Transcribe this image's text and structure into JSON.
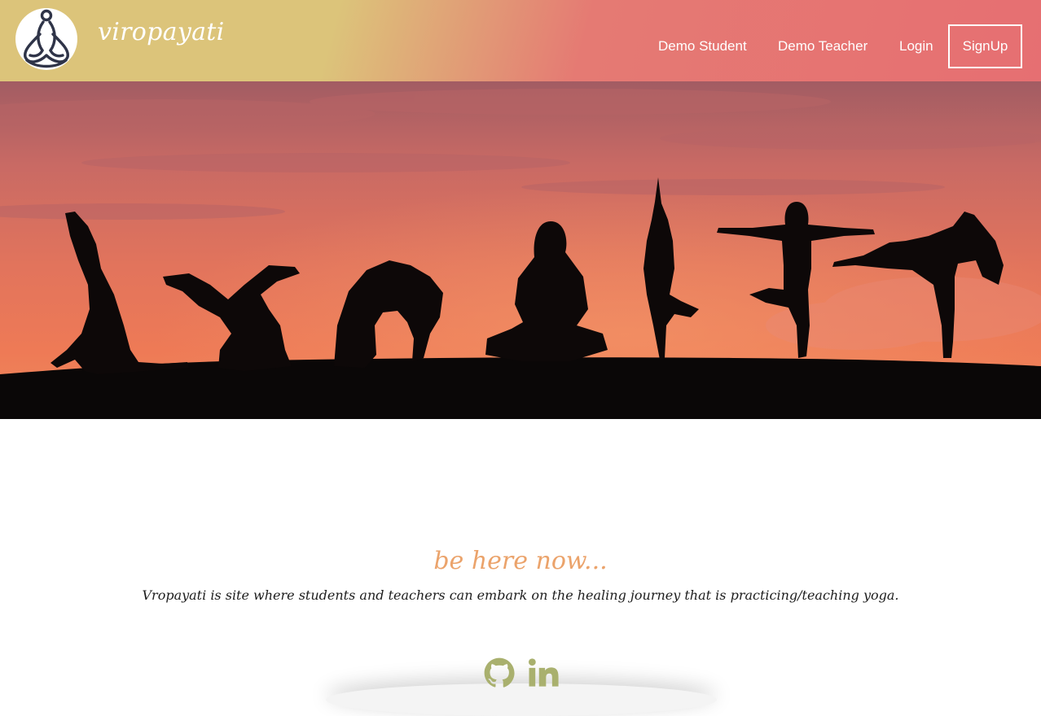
{
  "brand": {
    "name": "viropayati",
    "logo_icon": "meditation-figure-icon"
  },
  "nav": {
    "items": [
      {
        "label": "Demo Student"
      },
      {
        "label": "Demo Teacher"
      },
      {
        "label": "Login"
      }
    ],
    "signup_label": "SignUp"
  },
  "hero": {
    "image": "yoga-silhouettes-sunset"
  },
  "main": {
    "tagline": "be here now...",
    "description": "Vropayati is site where students and teachers can embark on the healing journey that is practicing/teaching yoga."
  },
  "footer": {
    "icons": [
      "github-icon",
      "linkedin-icon"
    ]
  },
  "colors": {
    "nav_gradient_start": "#dcc47a",
    "nav_gradient_end": "#e66f72",
    "tagline": "#eba36b",
    "social_icons": "#a9b06e"
  }
}
